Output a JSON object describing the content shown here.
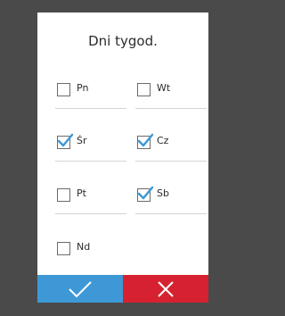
{
  "dialog": {
    "title": "Dni tygod."
  },
  "days": [
    {
      "id": "pn",
      "label": "Pn",
      "checked": false
    },
    {
      "id": "wt",
      "label": "Wt",
      "checked": false
    },
    {
      "id": "sr",
      "label": "Śr",
      "checked": true
    },
    {
      "id": "cz",
      "label": "Cz",
      "checked": true
    },
    {
      "id": "pt",
      "label": "Pt",
      "checked": false
    },
    {
      "id": "sb",
      "label": "Sb",
      "checked": true
    },
    {
      "id": "nd",
      "label": "Nd",
      "checked": false
    }
  ],
  "buttons": {
    "confirm_icon": "checkmark-icon",
    "cancel_icon": "close-icon"
  },
  "colors": {
    "accent": "#3e98d6",
    "danger": "#d62230",
    "background": "#4a4a4a"
  }
}
